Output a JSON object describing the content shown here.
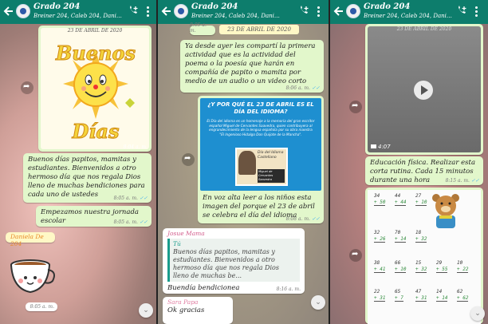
{
  "chat": {
    "title": "Grado 204",
    "participants": "Breiner 204, Caleb 204, Daniel Ricardo 204..."
  },
  "panel1": {
    "sun_greeting": [
      "Buenos",
      "Días"
    ],
    "image_date": "23 DE ABRIL DE 2020",
    "image_time": "8:04 a. m.",
    "message1": "Buenos días papitos, mamitas y estudiantes. Bienvenidos a otro hermoso día que nos regala Dios lleno de muchas bendiciones para cada uno de ustedes",
    "message1_time": "8:05 a. m.",
    "message2": "Empezamos nuestra jornada escolar",
    "message2_time": "8:05 a. m.",
    "sender": "Daniela De 204",
    "sticker_time": "8:05 a. m."
  },
  "panel2": {
    "time_top": "8:05 a. m.",
    "date_label": "23 DE ABRIL DE 2020",
    "message1": "Ya desde ayer les compartí la primera actividad que es la actividad del poema o la poesía que harán en compañía de papito o mamita por medio de un audio o un video corto",
    "message1_time": "8:06 a. m.",
    "infographic_title": "¿Y POR QUÉ EL 23 DE ABRIL ES EL DÍA DEL IDIOMA?",
    "infographic_body": "El Día del idioma es un homenaje a la memoria del gran escritor español Miguel de Cervantes Saavedra, quien contribuyera al engrandecimiento de la lengua española por su obra maestra \"El Ingenioso Hidalgo Don Quijote de la Mancha\".",
    "portrait_caption": "Día del Idioma Castellano",
    "portrait_name": "Miguel de Cervantes Saavedra",
    "message2": "En voz alta leer a los niños esta imagen del porque el 23 de abril se celebra el día del idioma",
    "message2_time": "8:08 a. m.",
    "reply_sender": "Josue Mama",
    "quote_sender": "Tú",
    "quote_text": "Buenos días papitos, mamitas y estudiantes. Bienvenidos a otro hermoso día que nos regala Dios lleno de muchas be...",
    "reply_text": "Buendía bendicionea",
    "reply_time": "8:16 a. m.",
    "next_sender": "Sara Papa",
    "next_text": "Ok gracias"
  },
  "panel3": {
    "image_date": "23 DE ABRIL DE 2020",
    "video_duration": "4:07",
    "message1": "Educación física. Realizar esta corta rutina. Cada 15 minutos durante una hora",
    "message1_time": "8:15 a. m.",
    "math_rows": [
      [
        "34",
        "44",
        "27",
        "32",
        "58"
      ],
      [
        "+ 50",
        "+ 44",
        "+ 10",
        "+ 65",
        "+ 12"
      ],
      [
        "32",
        "70",
        "18",
        "",
        ""
      ],
      [
        "+ 26",
        "+ 14",
        "+ 32",
        "",
        ""
      ],
      [
        "38",
        "66",
        "15",
        "29",
        "10"
      ],
      [
        "+ 41",
        "+ 10",
        "+ 32",
        "+ 55",
        "+ 22"
      ],
      [
        "22",
        "65",
        "47",
        "14",
        "62"
      ],
      [
        "+ 31",
        "+ 7",
        "+ 31",
        "+ 14",
        "+ 62"
      ]
    ]
  },
  "colors": {
    "header": "#0d7d6c",
    "outgoing_bubble": "#e2f7cb",
    "infographic": "#1e8fd0",
    "date_chip": "#fff8c6"
  }
}
